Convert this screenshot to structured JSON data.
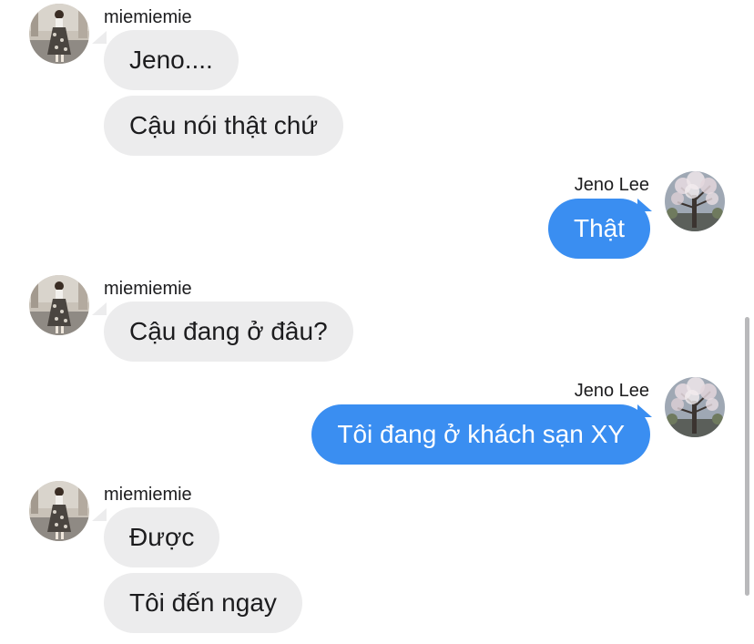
{
  "contacts": {
    "other": {
      "name": "miemiemie",
      "avatar_icon": "woman-photo-avatar"
    },
    "me": {
      "name": "Jeno Lee",
      "avatar_icon": "cherry-blossom-tree-avatar"
    }
  },
  "colors": {
    "incoming_bubble": "#ececed",
    "outgoing_bubble": "#3a8ef1"
  },
  "messages": [
    {
      "sender": "miemiemie",
      "text": "Jeno...."
    },
    {
      "sender": "miemiemie",
      "text": "Cậu nói thật chứ"
    },
    {
      "sender": "Jeno Lee",
      "text": "Thật"
    },
    {
      "sender": "miemiemie",
      "text": "Cậu đang ở đâu?"
    },
    {
      "sender": "Jeno Lee",
      "text": "Tôi đang ở khách sạn XY"
    },
    {
      "sender": "miemiemie",
      "text": "Được"
    },
    {
      "sender": "miemiemie",
      "text": "Tôi đến ngay"
    }
  ]
}
